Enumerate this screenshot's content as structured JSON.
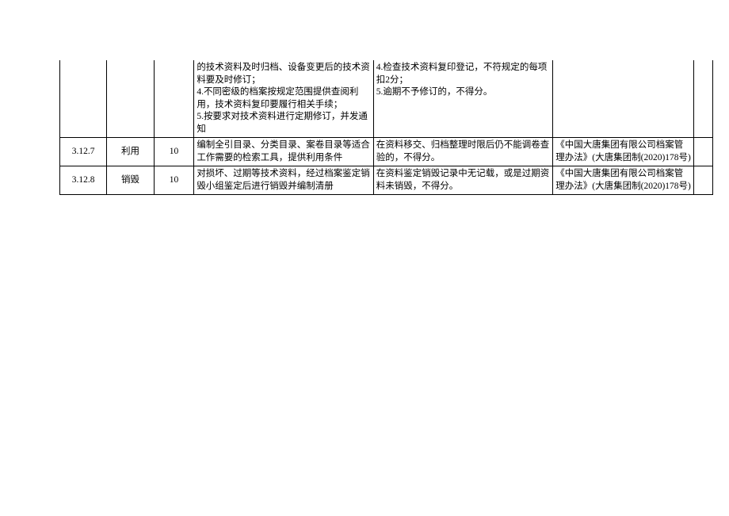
{
  "rows": [
    {
      "id": "",
      "name": "",
      "score": "",
      "requirements": "的技术资料及时归档、设备变更后的技术资料要及时修订；\n4.不同密级的档案按规定范围提供查阅利用，技术资料复印要履行相关手续；\n5.按要求对技术资料进行定期修订，并发通知",
      "deductions": "4.检查技术资料复印登记，不符规定的每项扣2分；\n5.逾期不予修订的，不得分。",
      "reference": "",
      "tail": ""
    },
    {
      "id": "3.12.7",
      "name": "利用",
      "score": "10",
      "requirements": "编制全引目录、分类目录、案卷目录等适合工作需要的检索工具，提供利用条件",
      "deductions": "在资料移交、归档整理时限后仍不能调卷查验的，不得分。",
      "reference": "《中国大唐集团有限公司档案管理办法》(大唐集团制(2020)178号)",
      "tail": ""
    },
    {
      "id": "3.12.8",
      "name": "销毁",
      "score": "10",
      "requirements": "对损坏、过期等技术资料，经过档案鉴定销毁小组鉴定后进行销毁并编制清册",
      "deductions": "在资料鉴定销毁记录中无记载，或是过期资料未销毁，不得分。",
      "reference": "《中国大唐集团有限公司档案管理办法》(大唐集团制(2020)178号)",
      "tail": ""
    }
  ]
}
